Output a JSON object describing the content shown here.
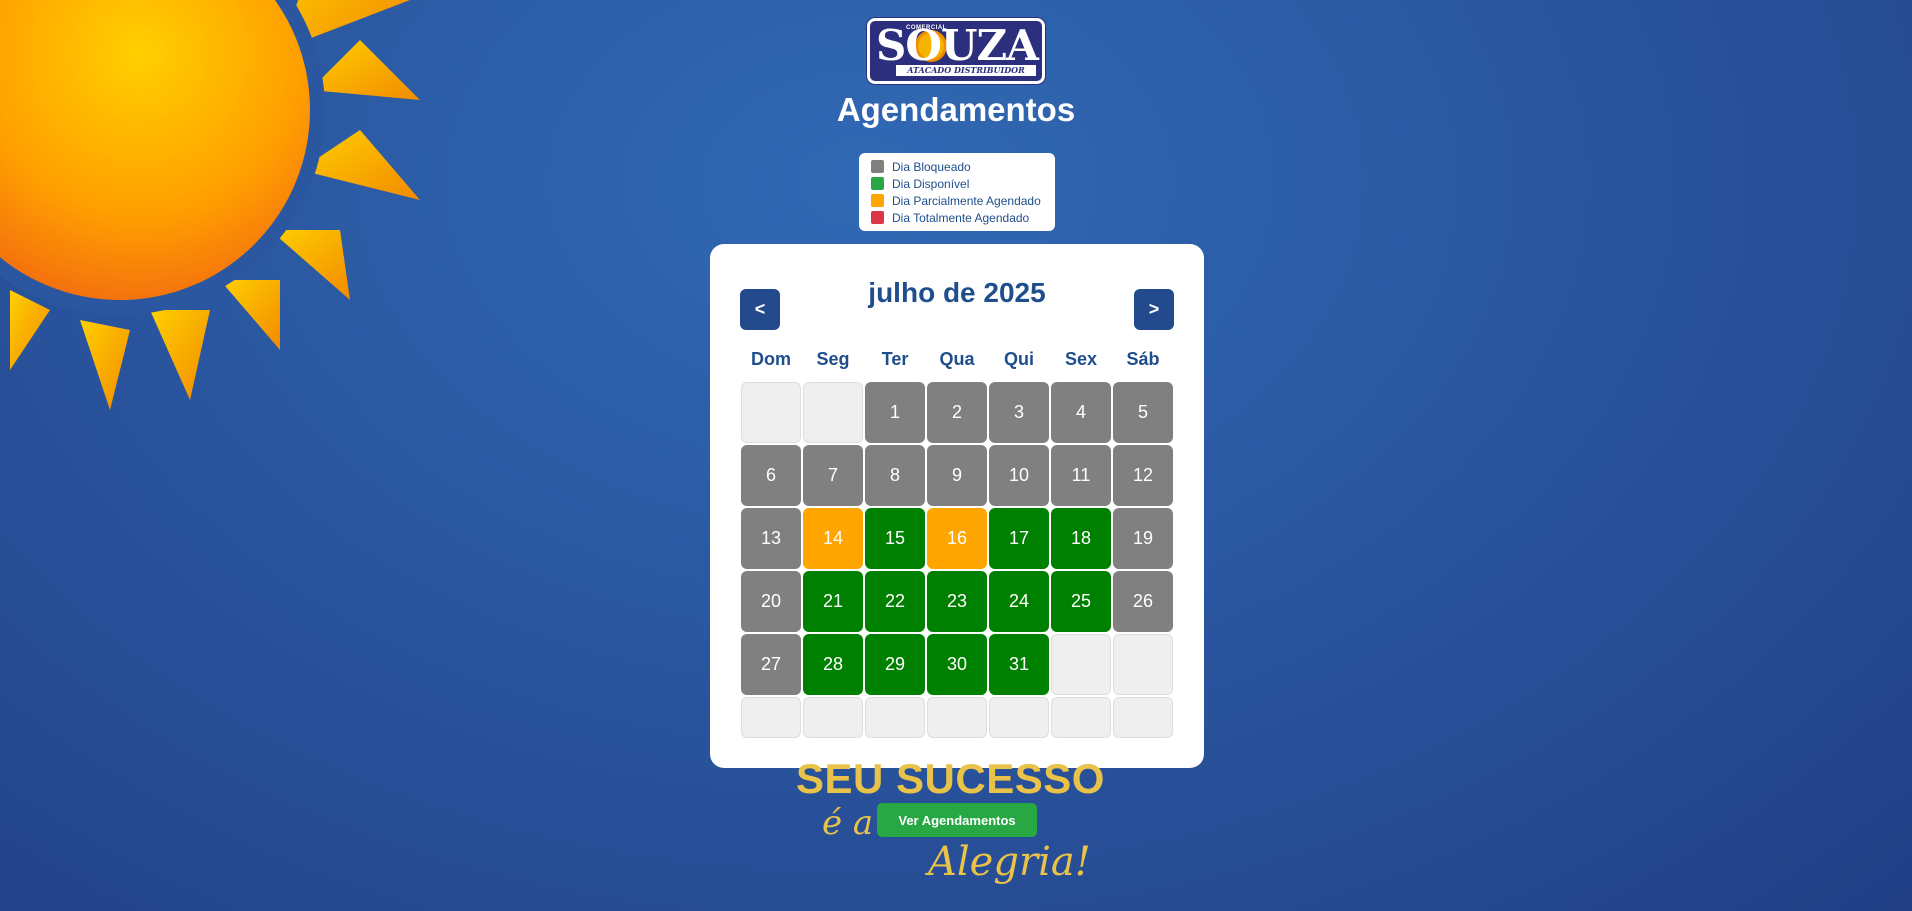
{
  "logo": {
    "small": "COMERCIAL",
    "brand": "SOUZA",
    "tagline": "ATACADO DISTRIBUIDOR"
  },
  "title": "Agendamentos",
  "legend": [
    {
      "label": "Dia Bloqueado",
      "color": "#808080"
    },
    {
      "label": "Dia Disponível",
      "color": "#28a745"
    },
    {
      "label": "Dia Parcialmente Agendado",
      "color": "#ffa500"
    },
    {
      "label": "Dia Totalmente Agendado",
      "color": "#dc3545"
    }
  ],
  "calendar": {
    "month_label": "julho de 2025",
    "prev_label": "<",
    "next_label": ">",
    "weekdays": [
      "Dom",
      "Seg",
      "Ter",
      "Qua",
      "Qui",
      "Sex",
      "Sáb"
    ],
    "days": [
      {
        "label": "",
        "status": "empty"
      },
      {
        "label": "",
        "status": "empty"
      },
      {
        "label": "1",
        "status": "blocked"
      },
      {
        "label": "2",
        "status": "blocked"
      },
      {
        "label": "3",
        "status": "blocked"
      },
      {
        "label": "4",
        "status": "blocked"
      },
      {
        "label": "5",
        "status": "blocked"
      },
      {
        "label": "6",
        "status": "blocked"
      },
      {
        "label": "7",
        "status": "blocked"
      },
      {
        "label": "8",
        "status": "blocked"
      },
      {
        "label": "9",
        "status": "blocked"
      },
      {
        "label": "10",
        "status": "blocked"
      },
      {
        "label": "11",
        "status": "blocked"
      },
      {
        "label": "12",
        "status": "blocked"
      },
      {
        "label": "13",
        "status": "blocked"
      },
      {
        "label": "14",
        "status": "partial"
      },
      {
        "label": "15",
        "status": "available"
      },
      {
        "label": "16",
        "status": "partial"
      },
      {
        "label": "17",
        "status": "available"
      },
      {
        "label": "18",
        "status": "available"
      },
      {
        "label": "19",
        "status": "blocked"
      },
      {
        "label": "20",
        "status": "blocked"
      },
      {
        "label": "21",
        "status": "available"
      },
      {
        "label": "22",
        "status": "available"
      },
      {
        "label": "23",
        "status": "available"
      },
      {
        "label": "24",
        "status": "available"
      },
      {
        "label": "25",
        "status": "available"
      },
      {
        "label": "26",
        "status": "blocked"
      },
      {
        "label": "27",
        "status": "blocked"
      },
      {
        "label": "28",
        "status": "available"
      },
      {
        "label": "29",
        "status": "available"
      },
      {
        "label": "30",
        "status": "available"
      },
      {
        "label": "31",
        "status": "available"
      },
      {
        "label": "",
        "status": "empty"
      },
      {
        "label": "",
        "status": "empty"
      },
      {
        "label": "",
        "status": "empty"
      },
      {
        "label": "",
        "status": "empty"
      },
      {
        "label": "",
        "status": "empty"
      },
      {
        "label": "",
        "status": "empty"
      },
      {
        "label": "",
        "status": "empty"
      },
      {
        "label": "",
        "status": "empty"
      },
      {
        "label": "",
        "status": "empty"
      }
    ]
  },
  "slogan": {
    "line1": "SEU SUCESSO",
    "line2": "é a",
    "line3": "Alegria!"
  },
  "view_button": "Ver Agendamentos"
}
